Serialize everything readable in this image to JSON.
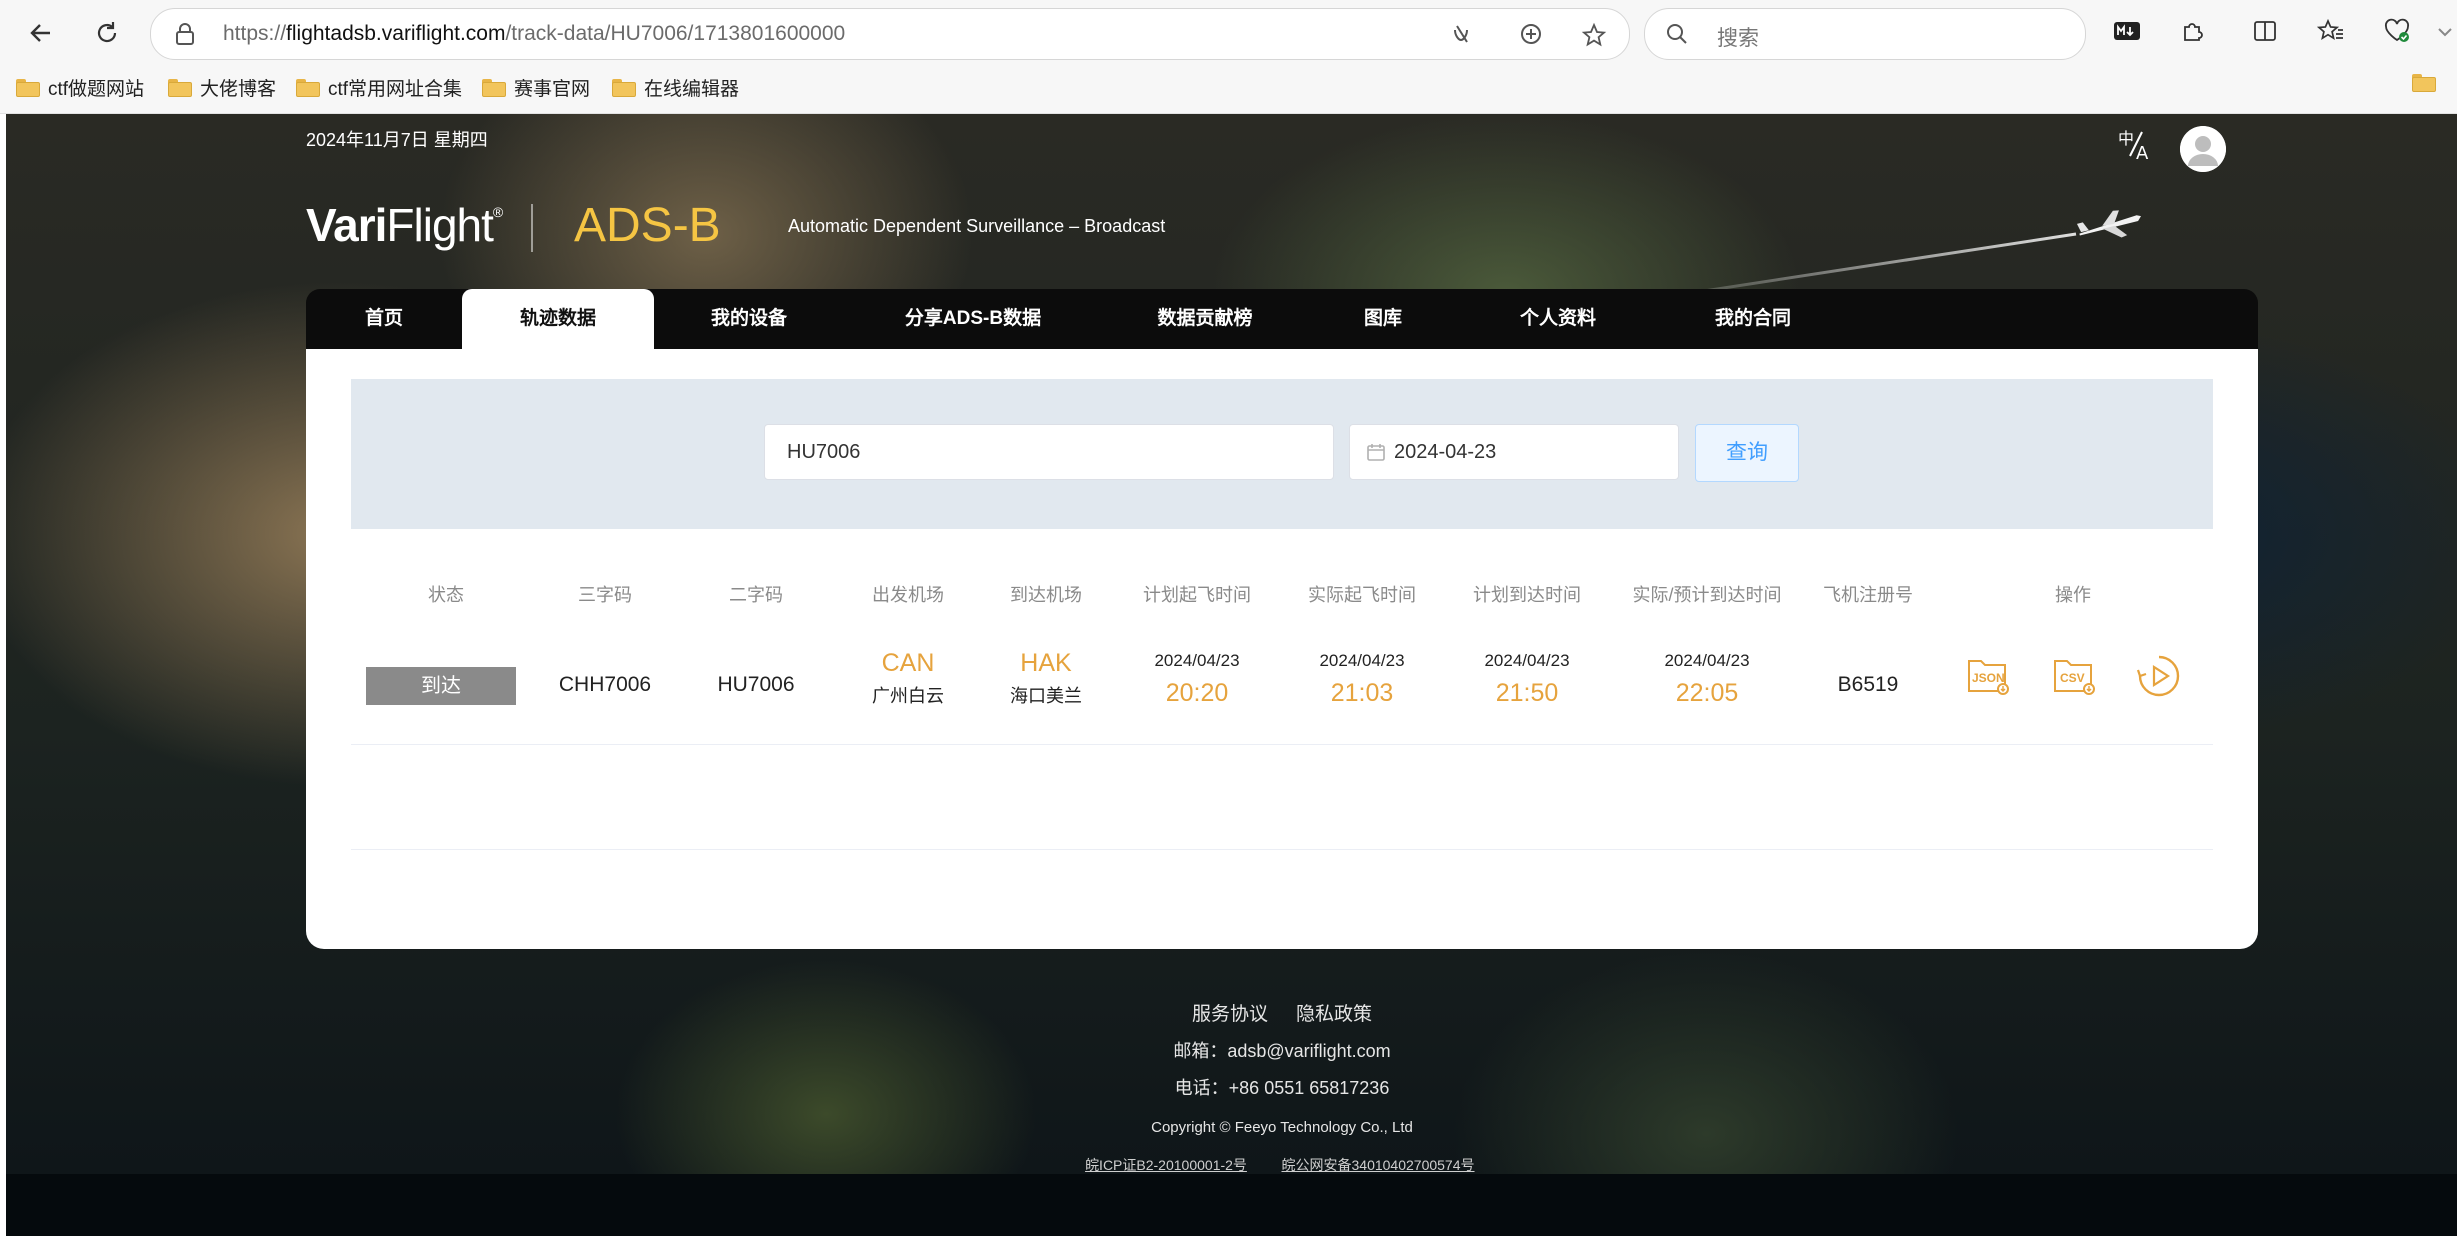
{
  "browser": {
    "url_prefix": "https://",
    "url_host": "flightadsb.variflight.com",
    "url_path": "/track-data/HU7006/1713801600000",
    "search_placeholder": "搜索",
    "bookmarks": [
      "ctf做题网站",
      "大佬博客",
      "ctf常用网址合集",
      "赛事官网",
      "在线编辑器"
    ]
  },
  "header": {
    "date": "2024年11月7日 星期四",
    "logo_bold": "Vari",
    "logo_rest": "Flight",
    "logo_mark": "®",
    "product": "ADS-B",
    "tagline": "Automatic Dependent Surveillance – Broadcast"
  },
  "nav": [
    "首页",
    "轨迹数据",
    "我的设备",
    "分享ADS-B数据",
    "数据贡献榜",
    "图库",
    "个人资料",
    "我的合同"
  ],
  "nav_active": "轨迹数据",
  "query": {
    "flight": "HU7006",
    "date": "2024-04-23",
    "button": "查询"
  },
  "table": {
    "headers": [
      "状态",
      "三字码",
      "二字码",
      "出发机场",
      "到达机场",
      "计划起飞时间",
      "实际起飞时间",
      "计划到达时间",
      "实际/预计到达时间",
      "飞机注册号",
      "操作"
    ],
    "row": {
      "status": "到达",
      "icao": "CHH7006",
      "iata": "HU7006",
      "dep_code": "CAN",
      "dep_name": "广州白云",
      "arr_code": "HAK",
      "arr_name": "海口美兰",
      "sched_dep_date": "2024/04/23",
      "sched_dep_time": "20:20",
      "actual_dep_date": "2024/04/23",
      "actual_dep_time": "21:03",
      "sched_arr_date": "2024/04/23",
      "sched_arr_time": "21:50",
      "actual_arr_date": "2024/04/23",
      "actual_arr_time": "22:05",
      "registration": "B6519",
      "ops": [
        "JSON",
        "CSV"
      ]
    }
  },
  "footer": {
    "terms": "服务协议",
    "privacy": "隐私政策",
    "email": "邮箱：adsb@variflight.com",
    "phone": "电话：+86 0551 65817236",
    "copyright": "Copyright © Feeyo Technology Co., Ltd",
    "icp": "皖ICP证B2-20100001-2号",
    "police": "皖公网安备34010402700574号"
  },
  "colors": {
    "accent_orange": "#e6a33d",
    "brand_yellow": "#f5c543",
    "query_blue": "#409eff"
  }
}
